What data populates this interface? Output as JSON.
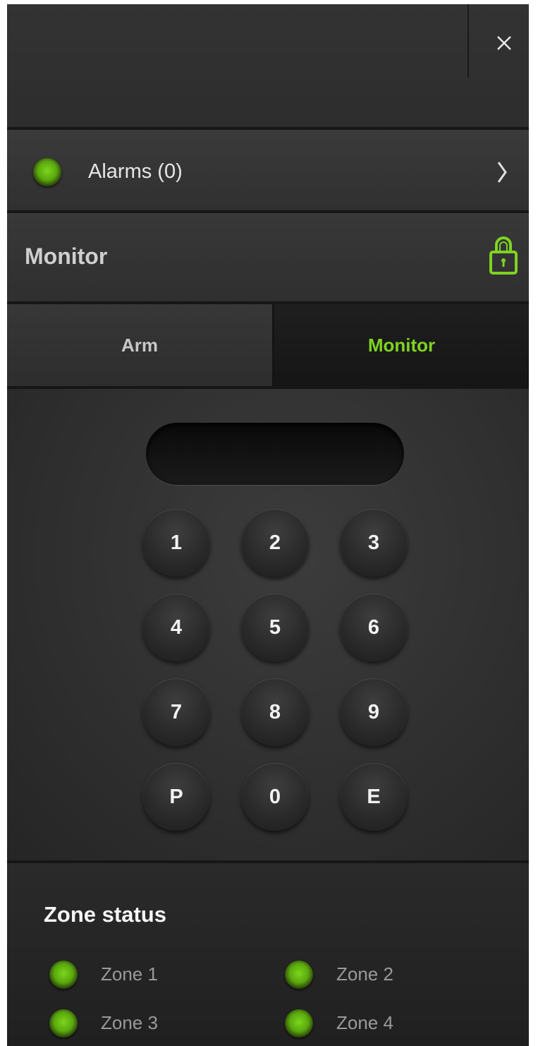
{
  "header": {
    "close_icon": "close-icon"
  },
  "alarms": {
    "label": "Alarms (0)",
    "status_color": "#7ed321",
    "icon": "chevron-right-icon"
  },
  "monitor_section": {
    "title": "Monitor",
    "lock_icon": "lock-icon",
    "lock_color": "#7ed321"
  },
  "tabs": [
    {
      "label": "Arm",
      "active": false
    },
    {
      "label": "Monitor",
      "active": true
    }
  ],
  "accent_color": "#7ed321",
  "keypad": {
    "display_value": "",
    "keys": [
      "1",
      "2",
      "3",
      "4",
      "5",
      "6",
      "7",
      "8",
      "9",
      "P",
      "0",
      "E"
    ]
  },
  "zones": {
    "title": "Zone status",
    "items": [
      {
        "label": "Zone 1",
        "status_color": "#7ed321"
      },
      {
        "label": "Zone 2",
        "status_color": "#7ed321"
      },
      {
        "label": "Zone 3",
        "status_color": "#7ed321"
      },
      {
        "label": "Zone 4",
        "status_color": "#7ed321"
      }
    ]
  }
}
